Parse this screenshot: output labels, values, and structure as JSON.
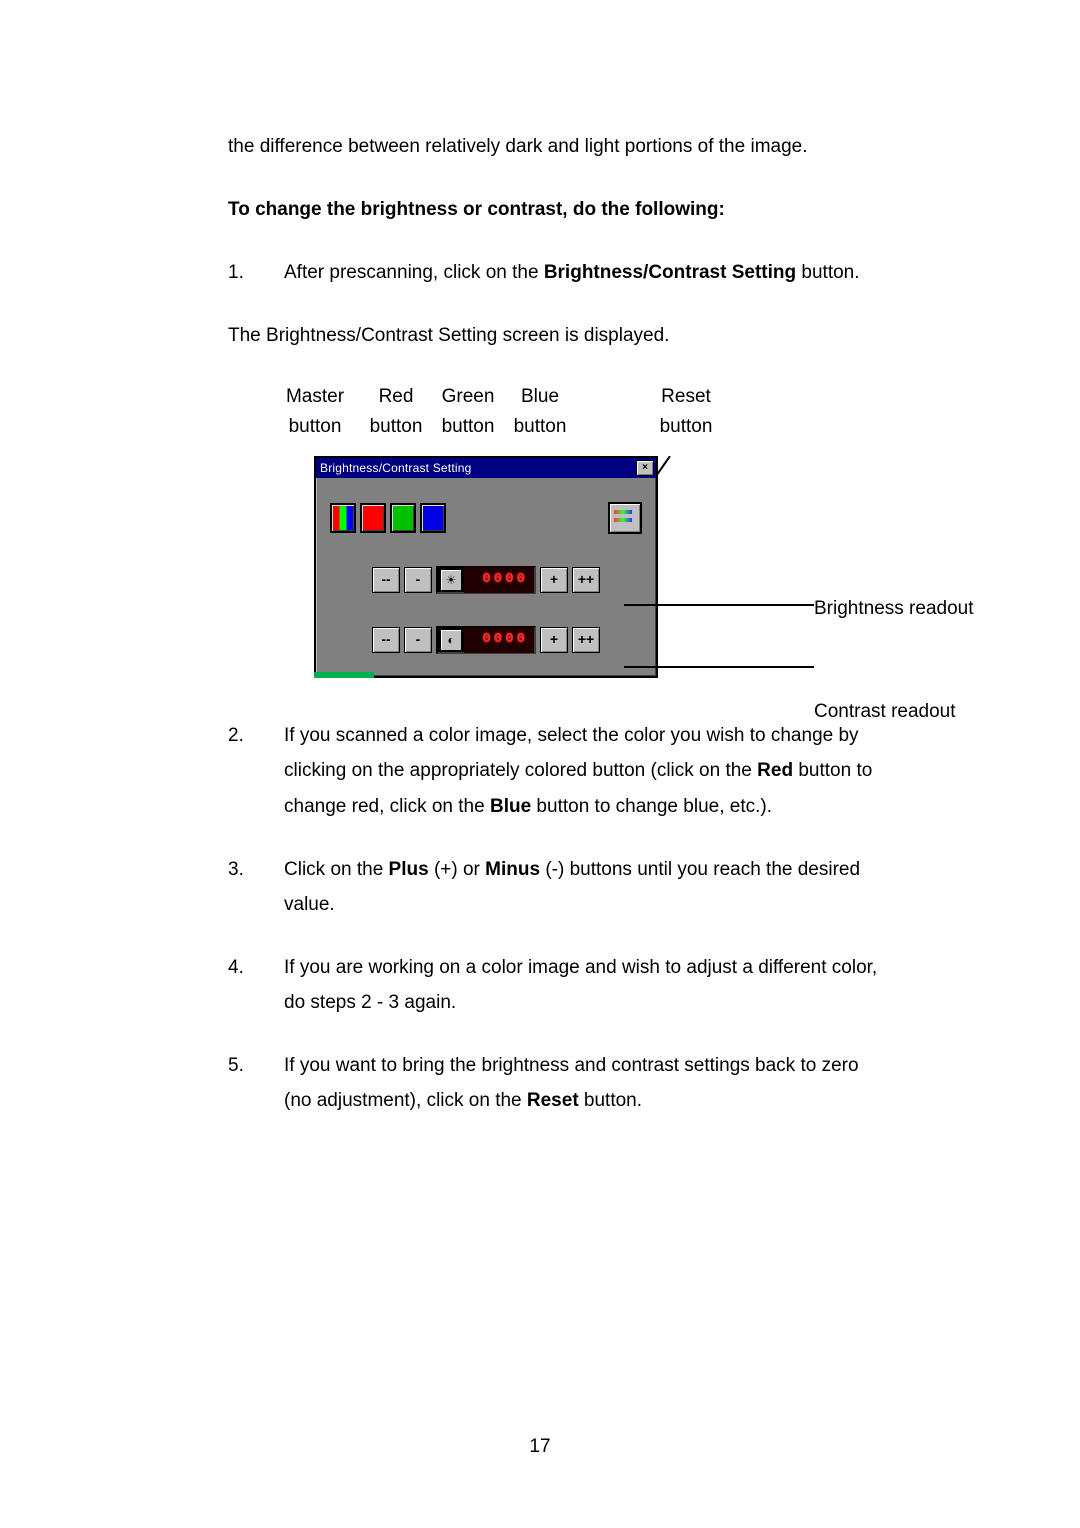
{
  "intro_paragraph": "the difference between relatively dark and light portions of the image.",
  "heading": "To change the brightness or contrast, do the following:",
  "step1_num": "1.",
  "step1_a": "After prescanning, click on the ",
  "step1_b": "Brightness/Contrast Setting",
  "step1_c": " button.",
  "after_step1": "The Brightness/Contrast Setting screen is displayed.",
  "labels": {
    "master_l1": "Master",
    "master_l2": "button",
    "red_l1": "Red",
    "red_l2": "button",
    "green_l1": "Green",
    "green_l2": "button",
    "blue_l1": "Blue",
    "blue_l2": "button",
    "reset_l1": "Reset",
    "reset_l2": "button"
  },
  "dialog": {
    "title": "Brightness/Contrast Setting",
    "close_glyph": "×",
    "brightness_value": "0000",
    "contrast_value": "0000",
    "brightness_icon": "☀",
    "contrast_icon": "◐",
    "minus2": "--",
    "minus1": "-",
    "plus1": "+",
    "plus2": "++"
  },
  "callouts": {
    "brightness": "Brightness readout",
    "contrast": "Contrast readout"
  },
  "step2_num": "2.",
  "step2_a": "If you scanned a color image, select the color you wish to change by clicking on the appropriately colored button (click on the ",
  "step2_b": "Red",
  "step2_c": " button to change red, click on the ",
  "step2_d": "Blue",
  "step2_e": " button to change blue, etc.).",
  "step3_num": "3.",
  "step3_a": "Click on the ",
  "step3_b": "Plus",
  "step3_c": " (+) or ",
  "step3_d": "Minus",
  "step3_e": " (-) buttons until you reach the desired value.",
  "step4_num": "4.",
  "step4": "If you are working on a color image and wish to adjust a different color, do steps 2 - 3 again.",
  "step5_num": "5.",
  "step5_a": "If you want to bring the brightness and contrast settings back to zero (no adjustment), click on the ",
  "step5_b": "Reset",
  "step5_c": " button.",
  "page_number": "17"
}
